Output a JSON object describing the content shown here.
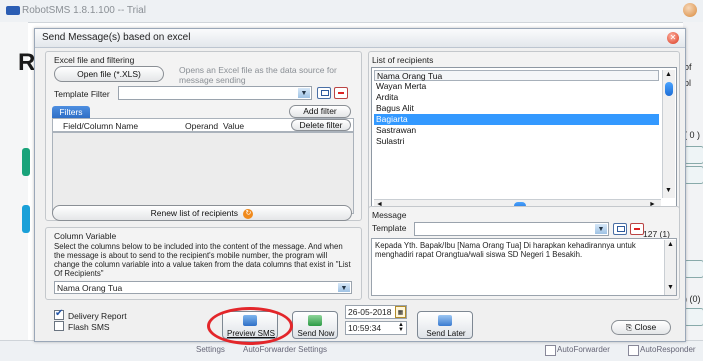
{
  "app": {
    "title": "RobotSMS 1.8.1.100 -- Trial",
    "bg_right_texts": [
      "of",
      "pl",
      "( 0 )",
      ") (0)"
    ],
    "bottom_tabs": [
      "Settings",
      "AutoForwarder Settings",
      "AutoForwarder",
      "AutoResponder"
    ],
    "bg_left_letter": "R"
  },
  "dialog": {
    "title": "Send Message(s) based on excel",
    "excel_group": {
      "label": "Excel file and filtering",
      "open_button": "Open file (*.XLS)",
      "open_hint": "Opens an Excel file as the data source for message sending",
      "template_filter_label": "Template Filter",
      "template_filter_value": ""
    },
    "filters": {
      "tab_label": "Filters",
      "add_button": "Add filter",
      "delete_button": "Delete filter",
      "columns": [
        "Field/Column Name",
        "Operand",
        "Value"
      ]
    },
    "renew_button": "Renew list of recipients",
    "column_variable": {
      "label": "Column Variable",
      "description": "Select the columns below to be included into the content of the message. And when the message is about to send to the recipient's mobile number, the program will change the column variable into a value taken from the data columns that exist in \"List Of Recipients\"",
      "selected": "Nama Orang Tua"
    },
    "recipients": {
      "label": "List of recipients",
      "header": "Nama Orang Tua",
      "items": [
        "Wayan Merta",
        "Ardita",
        "Bagus Alit",
        "Bagiarta",
        "Sastrawan",
        "Sulastri"
      ],
      "selected_index": 3
    },
    "message": {
      "label": "Message",
      "template_label": "Template",
      "template_value": "",
      "counter": "127 (1)",
      "text": "Kepada Yth. Bapak/Ibu [Nama Orang Tua] Di harapkan kehadirannya untuk menghadiri rapat Orangtua/wali siswa SD Negeri 1 Besakih."
    },
    "options": {
      "delivery_report": "Delivery Report",
      "delivery_report_checked": true,
      "flash_sms": "Flash SMS",
      "flash_sms_checked": false
    },
    "actions": {
      "preview": "Preview SMS",
      "send_now": "Send Now",
      "date": "26-05-2018",
      "time": "10:59:34",
      "send_later": "Send Later",
      "close": "Close"
    }
  },
  "colors": {
    "selection": "#3399ff",
    "filters_tab": "#2f6fc6",
    "highlight_ring": "#e3262a"
  }
}
